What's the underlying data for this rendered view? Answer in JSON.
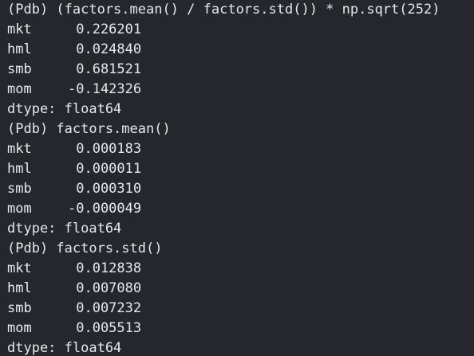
{
  "terminal": {
    "background": "#25272c",
    "text_color": "#e6e8eb",
    "blocks": [
      {
        "command": "(Pdb) (factors.mean() / factors.std()) * np.sqrt(252)",
        "rows": [
          {
            "name": "mkt",
            "value": " 0.226201"
          },
          {
            "name": "hml",
            "value": " 0.024840"
          },
          {
            "name": "smb",
            "value": " 0.681521"
          },
          {
            "name": "mom",
            "value": "-0.142326"
          }
        ],
        "dtype": "dtype: float64"
      },
      {
        "command": "(Pdb) factors.mean()",
        "rows": [
          {
            "name": "mkt",
            "value": " 0.000183"
          },
          {
            "name": "hml",
            "value": " 0.000011"
          },
          {
            "name": "smb",
            "value": " 0.000310"
          },
          {
            "name": "mom",
            "value": "-0.000049"
          }
        ],
        "dtype": "dtype: float64"
      },
      {
        "command": "(Pdb) factors.std()",
        "rows": [
          {
            "name": "mkt",
            "value": " 0.012838"
          },
          {
            "name": "hml",
            "value": " 0.007080"
          },
          {
            "name": "smb",
            "value": " 0.007232"
          },
          {
            "name": "mom",
            "value": " 0.005513"
          }
        ],
        "dtype": "dtype: float64"
      }
    ]
  }
}
